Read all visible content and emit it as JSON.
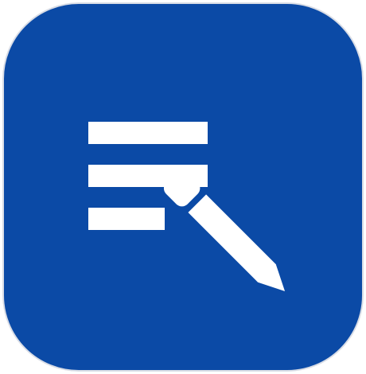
{
  "app_icon": {
    "icon_name": "notes-edit-icon",
    "colors": {
      "background": "#0b4aa6",
      "border": "#d9dde6",
      "glyph": "#ffffff"
    }
  }
}
